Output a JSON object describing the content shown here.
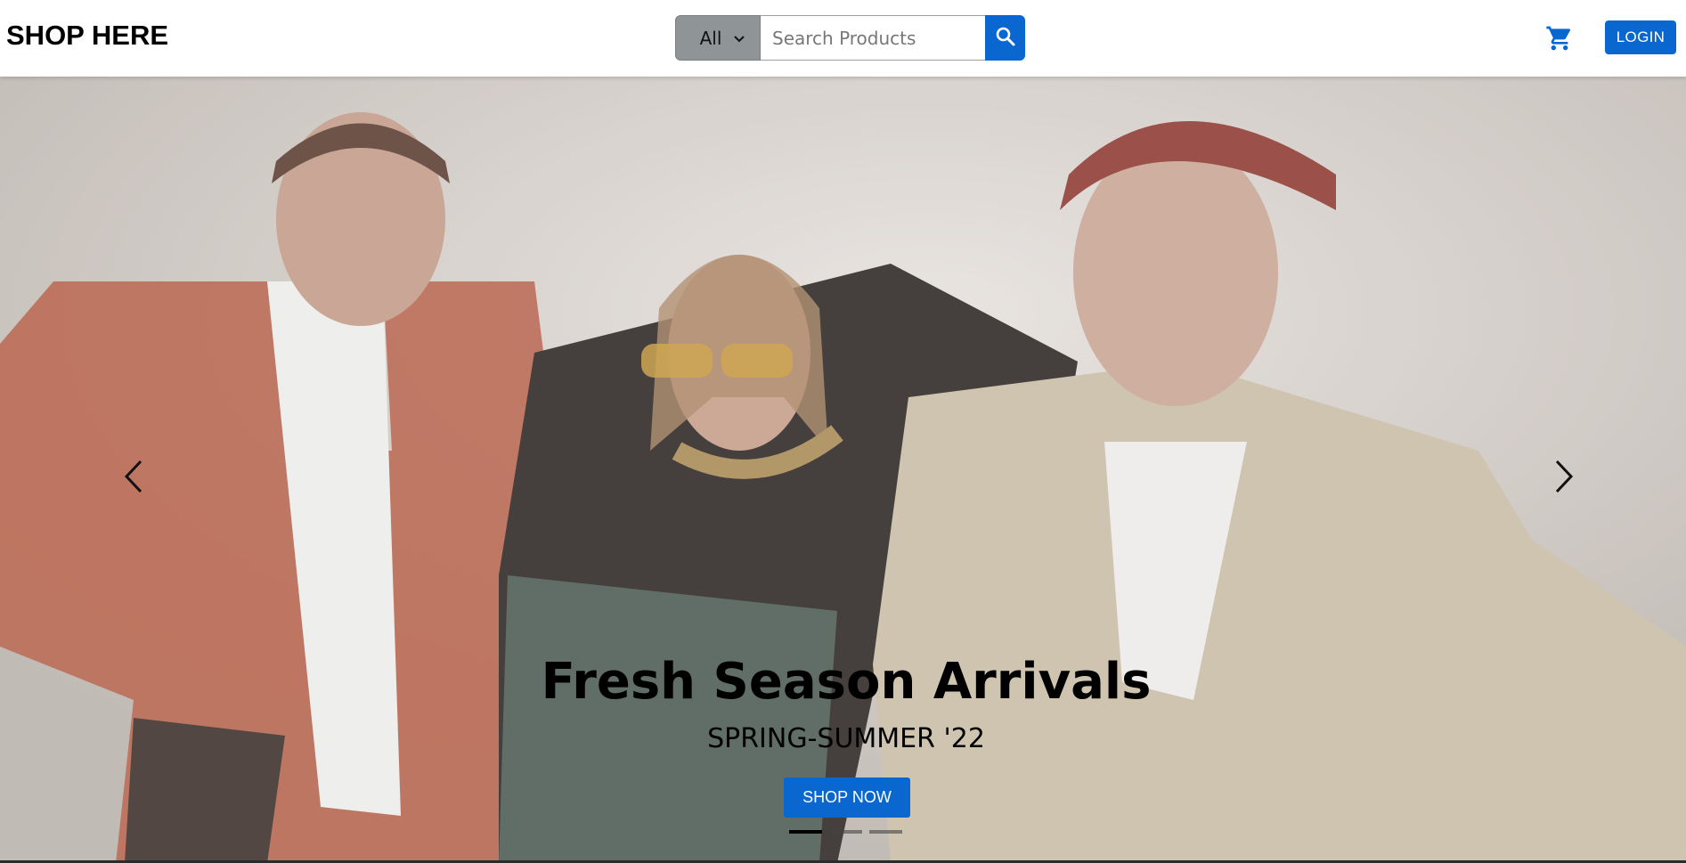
{
  "navbar": {
    "brand": "SHOP HERE",
    "category_select": "All",
    "search_placeholder": "Search Products",
    "login_label": "LOGIN",
    "accent_color": "#0b67d0"
  },
  "hero": {
    "title": "Fresh Season Arrivals",
    "subtitle": "SPRING-SUMMER '22",
    "cta_label": "SHOP NOW",
    "slides_count": 3,
    "active_slide": 1
  },
  "icons": {
    "search": "search-icon",
    "cart": "cart-icon",
    "prev": "chevron-left-icon",
    "next": "chevron-right-icon"
  }
}
